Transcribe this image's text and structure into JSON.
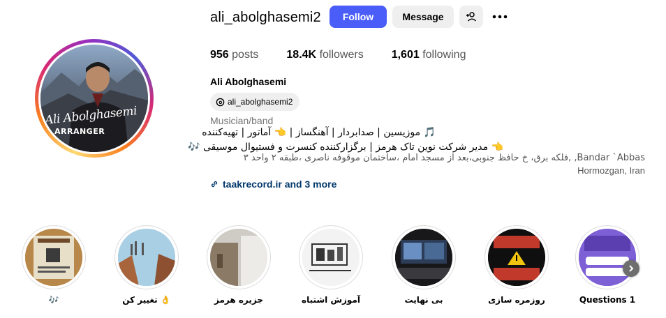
{
  "profile": {
    "username": "ali_abolghasemi2",
    "full_name": "Ali Abolghasemi",
    "threads_handle": "ali_abolghasemi2",
    "category": "Musician/band",
    "avatar_signature": "Ali Abolghasemi",
    "avatar_subtitle": "ARRANGER"
  },
  "actions": {
    "follow_label": "Follow",
    "message_label": "Message",
    "suggest_icon": "person-add-icon",
    "more_icon": "more-horizontal-icon",
    "follow_color": "#4a5df9"
  },
  "stats": {
    "posts_count": "956",
    "posts_label": "posts",
    "followers_count": "18.4K",
    "followers_label": "followers",
    "following_count": "1,601",
    "following_label": "following"
  },
  "bio": {
    "line1": "🎵 موزیسین | صدابردار | آهنگساز | 👈 آماتور | تهیه‌کننده",
    "line2": "👈 مدیر شرکت نوین تاک هرمز | برگزارکننده کنسرت و فستیوال موسیقی 🎶",
    "address_line1": "Bandar `Abbas, ,فلکه برق، خ حافظ جنوبی،بعد از مسجد امام ،ساختمان موقوفه ناصری ،طبقه ۲ واحد ۳",
    "address_line2": "Hormozgan, Iran",
    "link_text": "taakrecord.ir and 3 more"
  },
  "highlights": [
    {
      "label": "🎶"
    },
    {
      "label": "تغییر کن 👌"
    },
    {
      "label": "جزیره هرمز"
    },
    {
      "label": "آموزش اشتباه"
    },
    {
      "label": "بی نهایت"
    },
    {
      "label": "روزمره سازی"
    },
    {
      "label": "Questions 1"
    }
  ],
  "highlights_next_icon": "chevron-right-icon"
}
